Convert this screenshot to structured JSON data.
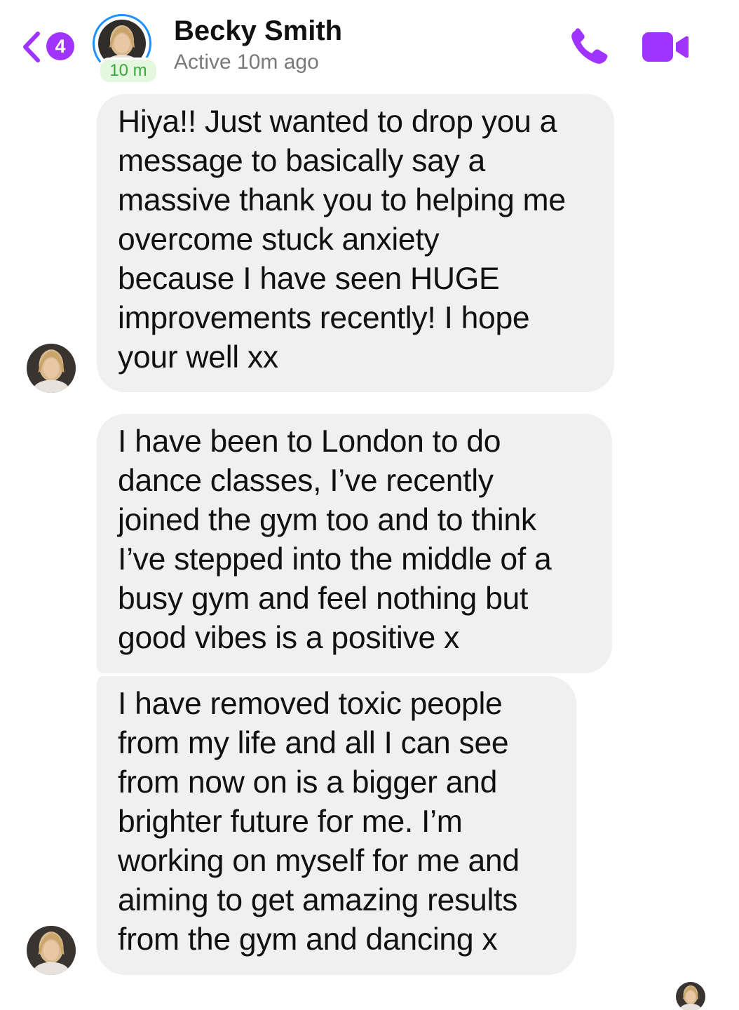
{
  "header": {
    "back_badge_count": "4",
    "contact_name": "Becky Smith",
    "active_pill": "10 m",
    "status": "Active 10m ago",
    "icons": {
      "back": "chevron-left-icon",
      "call": "phone-icon",
      "video": "video-camera-icon"
    },
    "accent_color": "#a033ff"
  },
  "messages": [
    {
      "lines": [
        "Hiya!! Just wanted to drop you a",
        "message to basically say a",
        "massive thank you to helping me",
        "overcome stuck anxiety",
        "because I have seen HUGE",
        "improvements recently! I hope",
        "your well xx"
      ]
    },
    {
      "lines": [
        "I have been to London to do",
        "dance classes, I’ve recently",
        "joined the gym too and to think",
        "I’ve stepped into the middle of a",
        "busy gym and feel nothing but",
        "good vibes is a positive x"
      ]
    },
    {
      "lines": [
        "I have removed toxic people",
        "from my life and all I can see",
        "from now on is a bigger and",
        "brighter future for me. I’m",
        "working on myself for me and",
        "aiming to get amazing results",
        "from the gym and dancing x"
      ]
    }
  ],
  "colors": {
    "bubble_bg": "#f0f0f0",
    "active_ring": "#1e90ff",
    "active_green": "#3aa83a"
  }
}
